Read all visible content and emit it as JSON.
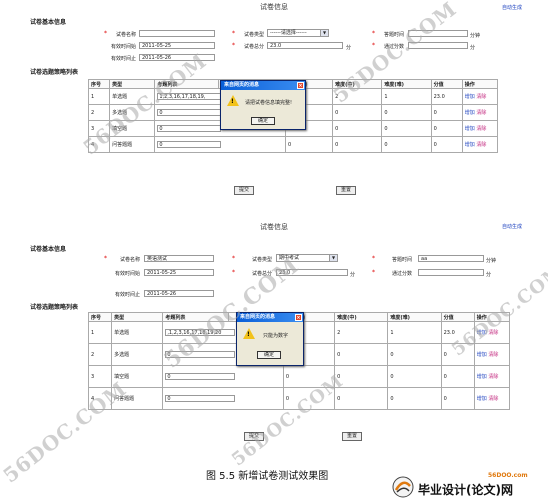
{
  "panels": [
    {
      "title": "试卷信息",
      "auto_generate": "自动生成",
      "basic_section": "试卷基本信息",
      "labels": {
        "name": "试卷名称",
        "type": "试卷类型",
        "time": "答题时间",
        "start": "有效时间始",
        "total": "试卷总分",
        "pass": "通过分数",
        "end": "有效时间止"
      },
      "values": {
        "name": "",
        "type": "------请选择------",
        "time": "",
        "start": "2011-05-25",
        "total": "23.0",
        "pass": "",
        "end": "2011-05-26"
      },
      "units": {
        "time": "分钟",
        "total": "分",
        "pass": "分"
      },
      "strategy_section": "试卷选题策略列表",
      "table_headers": [
        "序号",
        "类型",
        "考题列表",
        "",
        "数量(易)",
        "难度(中)",
        "难度(难)",
        "分值",
        "操作"
      ],
      "rows": [
        {
          "no": "1",
          "type": "单选题",
          "list": "1,2,3,16,17,18,19,",
          "c4": "0",
          "c5": "0",
          "c6": "2",
          "c7": "1",
          "score": "23.0",
          "add": "增加",
          "del": "清除"
        },
        {
          "no": "2",
          "type": "多选题",
          "list": "0",
          "c4": "0",
          "c5": "0",
          "c6": "0",
          "c7": "0",
          "score": "0",
          "add": "增加",
          "del": "清除"
        },
        {
          "no": "3",
          "type": "填空题",
          "list": "0",
          "c4": "0",
          "c5": "0",
          "c6": "0",
          "c7": "0",
          "score": "0",
          "add": "增加",
          "del": "清除"
        },
        {
          "no": "4",
          "type": "问答题题",
          "list": "0",
          "c4": "0",
          "c5": "0",
          "c6": "0",
          "c7": "0",
          "score": "0",
          "add": "增加",
          "del": "清除"
        }
      ],
      "submit": "提交",
      "reset": "重置",
      "dialog": {
        "title": "来自网页的消息",
        "message": "请把试卷信息填完整!",
        "ok": "确定"
      }
    },
    {
      "title": "试卷信息",
      "auto_generate": "自动生成",
      "basic_section": "试卷基本信息",
      "labels": {
        "name": "试卷名称",
        "type": "试卷类型",
        "time": "答题时间",
        "start": "有效时间始",
        "total": "试卷总分",
        "pass": "通过分数",
        "end": "有效时间止"
      },
      "values": {
        "name": "英语测试",
        "type": "期中考试",
        "time": "aa",
        "start": "2011-05-25",
        "total": "23.0",
        "pass": "",
        "end": "2011-05-26"
      },
      "units": {
        "time": "分钟",
        "total": "分",
        "pass": "分"
      },
      "strategy_section": "试卷选题策略列表",
      "table_headers": [
        "序号",
        "类型",
        "考题列表",
        "",
        "难度(易)",
        "难度(中)",
        "难度(难)",
        "分值",
        "操作"
      ],
      "rows": [
        {
          "no": "1",
          "type": "单选题",
          "list": ",1,2,3,16,17,18,19,20",
          "c4": "0",
          "c5": "0",
          "c6": "2",
          "c7": "1",
          "score": "23.0",
          "add": "增加",
          "del": "清除"
        },
        {
          "no": "2",
          "type": "多选题",
          "list": "0",
          "c4": "0",
          "c5": "0",
          "c6": "0",
          "c7": "0",
          "score": "0",
          "add": "增加",
          "del": "清除"
        },
        {
          "no": "3",
          "type": "填空题",
          "list": "0",
          "c4": "0",
          "c5": "0",
          "c6": "0",
          "c7": "0",
          "score": "0",
          "add": "增加",
          "del": "清除"
        },
        {
          "no": "4",
          "type": "问答题题",
          "list": "0",
          "c4": "0",
          "c5": "0",
          "c6": "0",
          "c7": "0",
          "score": "0",
          "add": "增加",
          "del": "清除"
        }
      ],
      "submit": "提交",
      "reset": "重置",
      "dialog": {
        "title": "来自网页的消息",
        "message": "只能为数字",
        "ok": "确定"
      }
    }
  ],
  "caption": "图 5.5  新增试卷测试效果图",
  "logo": {
    "domain": "56DOO.com",
    "text": "毕业设计(论文)网"
  },
  "watermark": "56DOC.COM"
}
